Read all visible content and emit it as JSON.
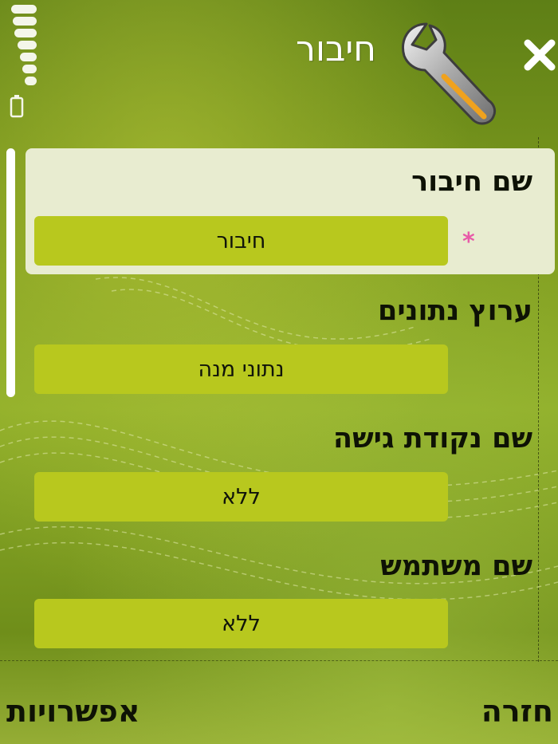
{
  "header": {
    "title": "חיבור",
    "app_icon": "wrench-icon",
    "close_icon": "close-icon"
  },
  "status": {
    "signal_icon": "signal-strength-icon",
    "battery_icon": "battery-icon"
  },
  "fields": [
    {
      "label": "שם חיבור",
      "value": "חיבור",
      "required": true,
      "required_mark": "*"
    },
    {
      "label": "ערוץ נתונים",
      "value": "נתוני מנה",
      "required": false
    },
    {
      "label": "שם נקודת גישה",
      "value": "ללא",
      "required": false
    },
    {
      "label": "שם משתמש",
      "value": "ללא",
      "required": false
    }
  ],
  "softkeys": {
    "left": "אפשרויות",
    "right": "חזרה"
  },
  "colors": {
    "background": "#7d9a1e",
    "field_fill": "#b8c81e",
    "selected_row": "#e8ecd0",
    "required_mark": "#e85aa8"
  }
}
